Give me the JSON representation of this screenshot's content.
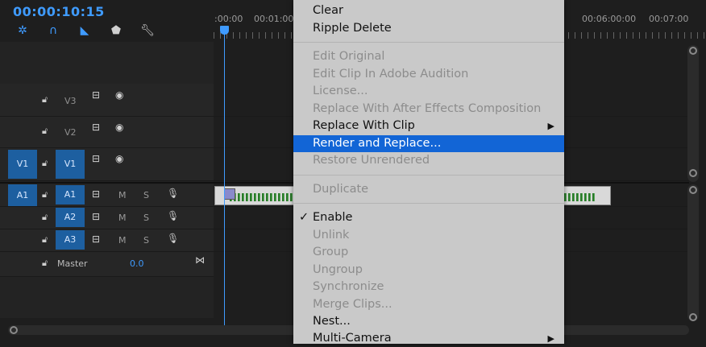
{
  "timecode": "00:00:10:15",
  "ruler_labels": [
    ":00:00",
    "00:01:00",
    "00:06:00:00",
    "00:07:00"
  ],
  "tracks": {
    "video": [
      {
        "name": "V3"
      },
      {
        "name": "V2"
      },
      {
        "source": "V1",
        "name": "V1"
      }
    ],
    "audio": [
      {
        "source": "A1",
        "name": "A1",
        "m": "M",
        "s": "S"
      },
      {
        "name": "A2",
        "m": "M",
        "s": "S"
      },
      {
        "name": "A3",
        "m": "M",
        "s": "S"
      }
    ],
    "master": {
      "label": "Master",
      "value": "0.0"
    }
  },
  "menu": {
    "clear": "Clear",
    "ripple_delete": "Ripple Delete",
    "edit_original": "Edit Original",
    "edit_audition": "Edit Clip In Adobe Audition",
    "license": "License...",
    "replace_ae": "Replace With After Effects Composition",
    "replace_clip": "Replace With Clip",
    "render_replace": "Render and Replace...",
    "restore_unrendered": "Restore Unrendered",
    "duplicate": "Duplicate",
    "enable": "Enable",
    "unlink": "Unlink",
    "group": "Group",
    "ungroup": "Ungroup",
    "synchronize": "Synchronize",
    "merge_clips": "Merge Clips...",
    "nest": "Nest...",
    "multi_camera": "Multi-Camera"
  },
  "icons": {
    "submenu": "▶",
    "check": "✓"
  },
  "colors": {
    "accent": "#3f9bff",
    "highlight": "#1265d6",
    "track_target": "#1d5fa0",
    "menu_bg": "#c9c9c9"
  }
}
